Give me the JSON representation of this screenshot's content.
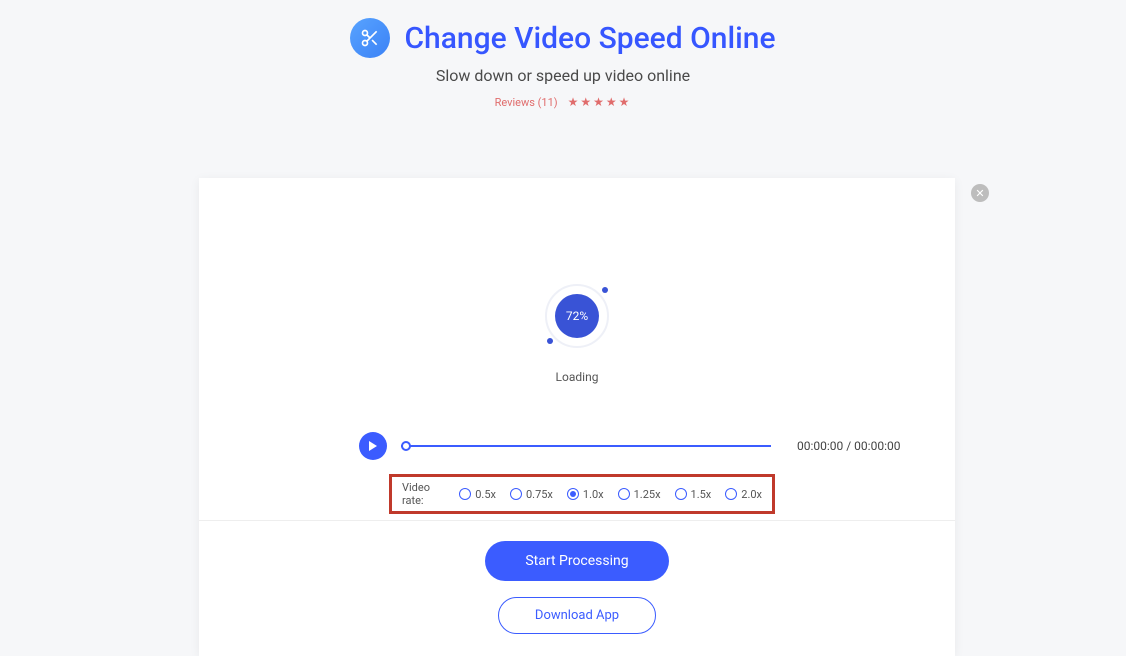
{
  "header": {
    "title": "Change Video Speed Online",
    "subtitle": "Slow down or speed up video online",
    "reviews_label": "Reviews (11)"
  },
  "panel": {
    "progress_percent": "72%",
    "loading_text": "Loading",
    "time_display": "00:00:00 / 00:00:00",
    "rate_label": "Video rate:",
    "rates": [
      "0.5x",
      "0.75x",
      "1.0x",
      "1.25x",
      "1.5x",
      "2.0x"
    ],
    "selected_rate_index": 2,
    "start_button": "Start Processing",
    "download_button": "Download App"
  }
}
